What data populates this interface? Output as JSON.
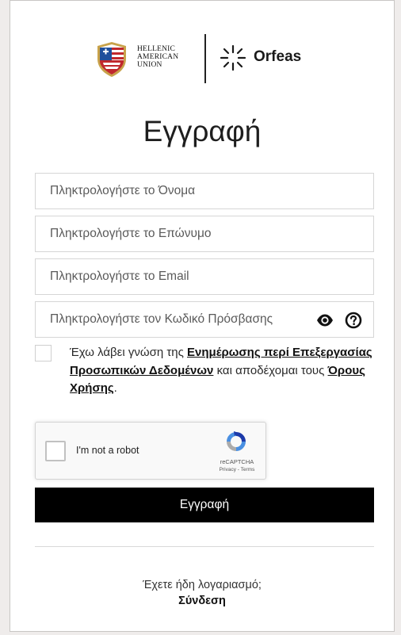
{
  "brand": {
    "hau_line1": "HELLENIC",
    "hau_line2": "AMERICAN",
    "hau_line3": "UNION",
    "orfeas": "Orfeas"
  },
  "title": "Εγγραφή",
  "fields": {
    "first_name_placeholder": "Πληκτρολογήστε το Όνομα",
    "last_name_placeholder": "Πληκτρολογήστε το Επώνυμο",
    "email_placeholder": "Πληκτρολογήστε το Email",
    "password_placeholder": "Πληκτρολογήστε τον Κωδικό Πρόσβασης"
  },
  "consent": {
    "text_1": "Έχω λάβει γνώση της ",
    "link_privacy": "Ενημέρωσης περί Επεξεργασίας Προσωπικών Δεδομένων",
    "text_2": " και αποδέχομαι τους ",
    "link_terms": "Όρους Χρήσης",
    "text_3": "."
  },
  "recaptcha": {
    "label": "I'm not a robot",
    "brand": "reCAPTCHA",
    "links": "Privacy - Terms"
  },
  "submit_label": "Εγγραφή",
  "footer": {
    "have_account": "Έχετε ήδη λογαριασμό;",
    "login": "Σύνδεση"
  },
  "colors": {
    "accent": "#000000",
    "page_bg": "#efeceb"
  },
  "icons": {
    "show_password": "eye-icon",
    "password_help": "question-circle-icon"
  }
}
